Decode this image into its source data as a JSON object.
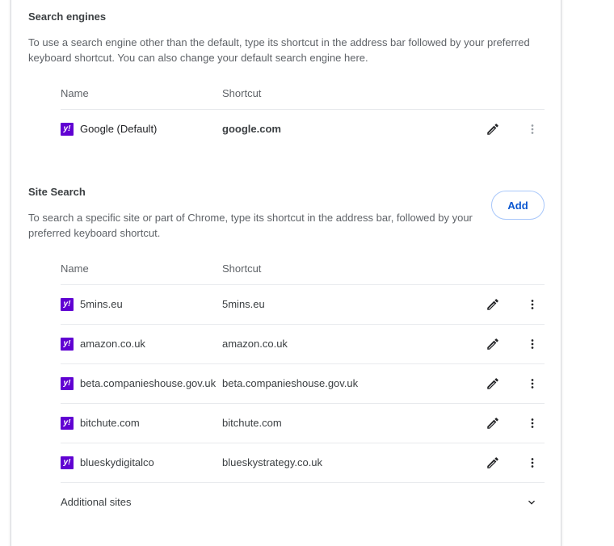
{
  "search_engines": {
    "title": "Search engines",
    "description_line1": "To use a search engine other than the default, type its shortcut in the address bar followed by your preferred",
    "description_line2": "keyboard shortcut. You can also change your default search engine here.",
    "col_name": "Name",
    "col_shortcut": "Shortcut",
    "rows": [
      {
        "name": "Google (Default)",
        "shortcut": "google.com",
        "favicon": "yahoo-icon"
      }
    ]
  },
  "site_search": {
    "title": "Site Search",
    "add_label": "Add",
    "description_line1": "To search a specific site or part of Chrome, type its shortcut in the address bar, followed by your",
    "description_line2": "preferred keyboard shortcut.",
    "col_name": "Name",
    "col_shortcut": "Shortcut",
    "rows": [
      {
        "name": "5mins.eu",
        "shortcut": "5mins.eu",
        "favicon": "yahoo-icon"
      },
      {
        "name": "amazon.co.uk",
        "shortcut": "amazon.co.uk",
        "favicon": "yahoo-icon"
      },
      {
        "name": "beta.companieshouse.gov.uk",
        "shortcut": "beta.companieshouse.gov.uk",
        "favicon": "yahoo-icon"
      },
      {
        "name": "bitchute.com",
        "shortcut": "bitchute.com",
        "favicon": "yahoo-icon"
      },
      {
        "name": "blueskydigitalco",
        "shortcut": "blueskystrategy.co.uk",
        "favicon": "yahoo-icon"
      }
    ],
    "additional_sites_label": "Additional sites"
  },
  "favicon_glyph": "y!",
  "colors": {
    "accent": "#0b57d0",
    "favicon_bg": "#6001d2"
  }
}
